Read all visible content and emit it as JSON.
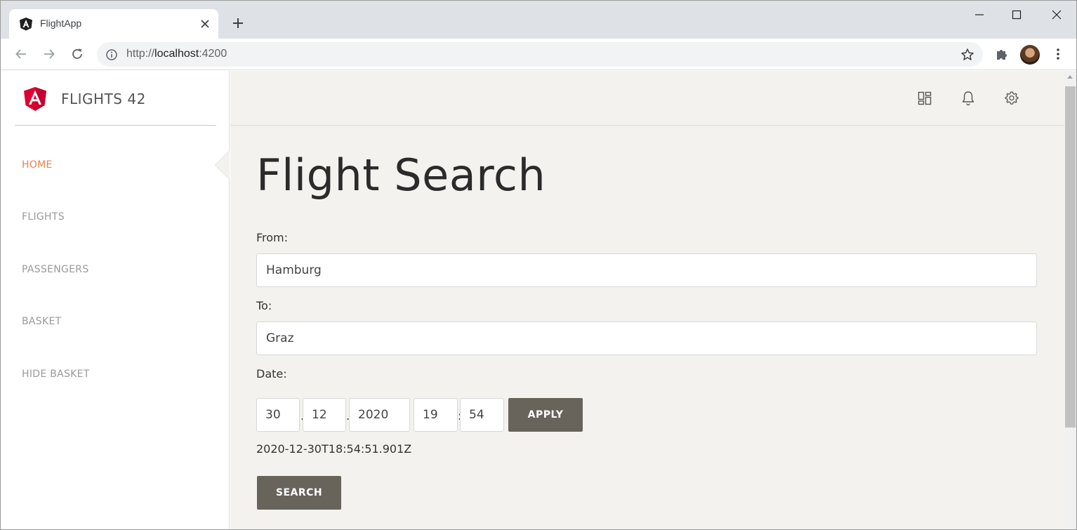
{
  "browser": {
    "tab_title": "FlightApp",
    "url_scheme": "http://",
    "url_host": "localhost",
    "url_port": ":4200"
  },
  "sidebar": {
    "brand_title": "FLIGHTS 42",
    "items": [
      {
        "label": "HOME",
        "active": true
      },
      {
        "label": "FLIGHTS",
        "active": false
      },
      {
        "label": "PASSENGERS",
        "active": false
      },
      {
        "label": "BASKET",
        "active": false
      },
      {
        "label": "HIDE BASKET",
        "active": false
      }
    ]
  },
  "main": {
    "title": "Flight Search",
    "from_label": "From:",
    "from_value": "Hamburg",
    "to_label": "To:",
    "to_value": "Graz",
    "date_label": "Date:",
    "date": {
      "day": "30",
      "month": "12",
      "year": "2020",
      "hour": "19",
      "minute": "54"
    },
    "apply_label": "APPLY",
    "iso_date": "2020-12-30T18:54:51.901Z",
    "search_label": "SEARCH"
  },
  "colors": {
    "accent": "#e8834f",
    "button": "#68645c",
    "main_bg": "#f3f2ee",
    "angular_red": "#dd0031"
  }
}
